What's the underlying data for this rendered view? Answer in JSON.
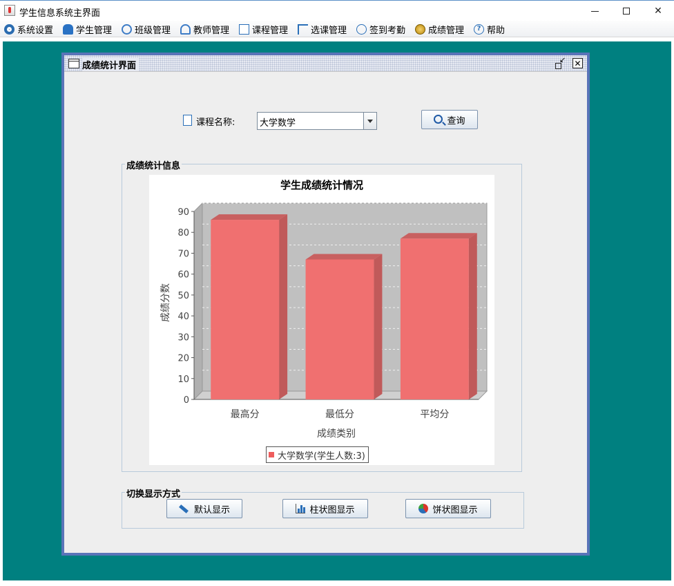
{
  "window": {
    "title": "学生信息系统主界面",
    "close_glyph": "✕"
  },
  "menu": [
    {
      "icon": "gear-icon",
      "label": "系统设置"
    },
    {
      "icon": "student-icon",
      "label": "学生管理"
    },
    {
      "icon": "class-icon",
      "label": "班级管理"
    },
    {
      "icon": "teacher-icon",
      "label": "教师管理"
    },
    {
      "icon": "course-icon",
      "label": "课程管理"
    },
    {
      "icon": "select-course-icon",
      "label": "选课管理"
    },
    {
      "icon": "attendance-icon",
      "label": "签到考勤"
    },
    {
      "icon": "score-icon",
      "label": "成绩管理"
    },
    {
      "icon": "help-icon",
      "label": "帮助"
    }
  ],
  "frame": {
    "title": "成绩统计界面",
    "close_glyph": "✕"
  },
  "query": {
    "course_label": "课程名称:",
    "course_value": "大学数学",
    "button_label": "查询"
  },
  "stats_group": {
    "legend": "成绩统计信息"
  },
  "switch_group": {
    "legend": "切换显示方式",
    "default_label": "默认显示",
    "bar_label": "柱状图显示",
    "pie_label": "饼状图显示"
  },
  "colors": {
    "desktop": "#008080",
    "bar": "#f07070",
    "plot_bg": "#c0c0c0"
  },
  "chart_data": {
    "type": "bar",
    "title": "学生成绩统计情况",
    "xlabel": "成绩类别",
    "ylabel": "成绩分数",
    "categories": [
      "最高分",
      "最低分",
      "平均分"
    ],
    "series": [
      {
        "name": "大学数学(学生人数:3)",
        "values": [
          86,
          67,
          77
        ]
      }
    ],
    "ylim": [
      0,
      90
    ],
    "yticks": [
      0,
      10,
      20,
      30,
      40,
      50,
      60,
      70,
      80,
      90
    ],
    "grid": true,
    "legend_position": "bottom"
  }
}
